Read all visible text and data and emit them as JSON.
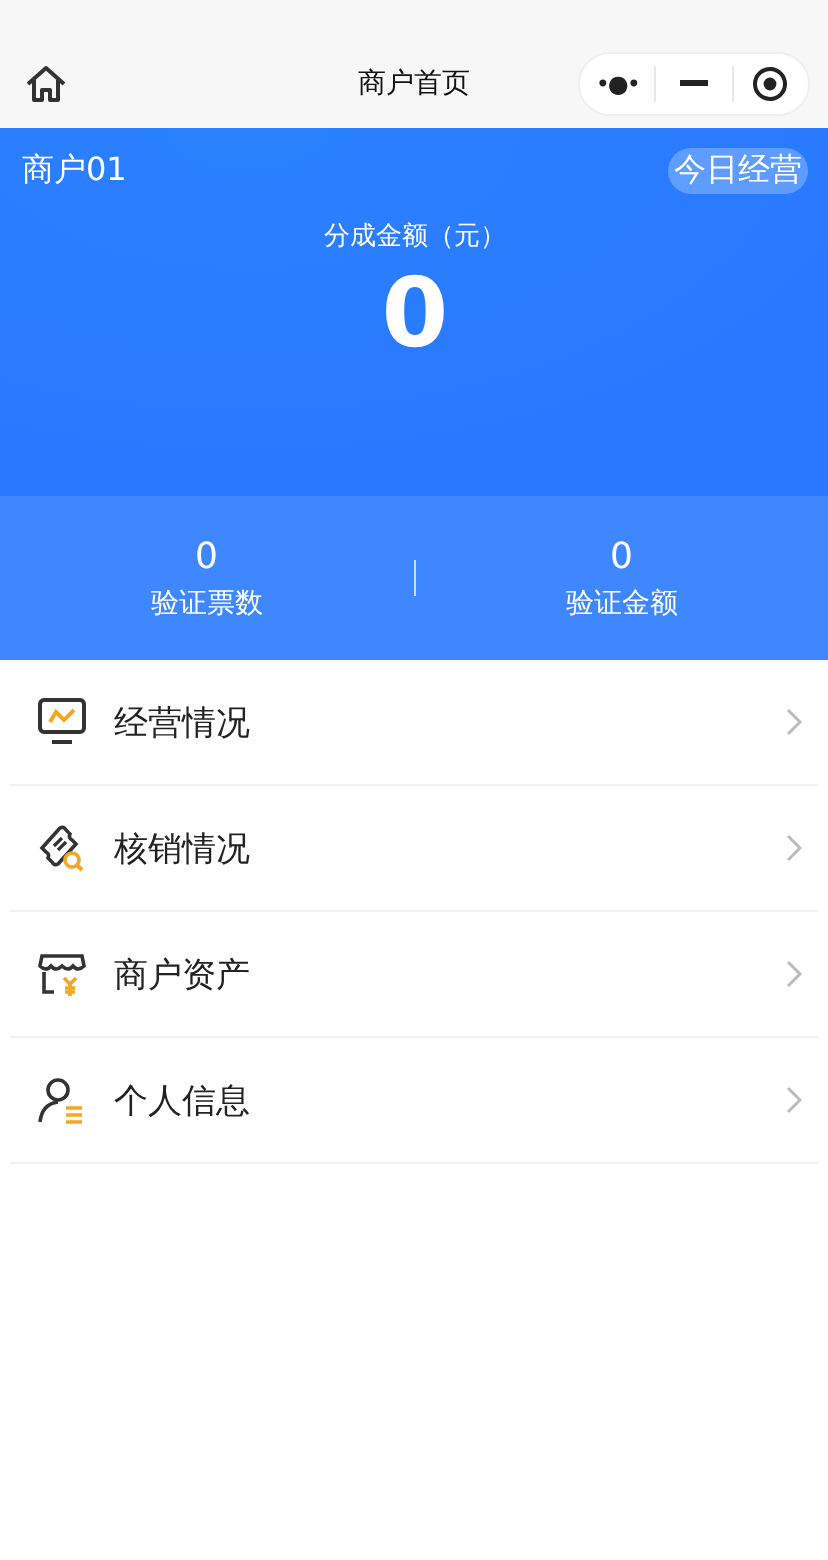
{
  "nav_bar": {
    "title": "商户首页",
    "capsule": {
      "more": "•●•"
    }
  },
  "header": {
    "merchant": "商户01",
    "badge": "今日经营",
    "amount_label": "分成金额（元）",
    "amount": "0"
  },
  "stats": [
    {
      "value": "0",
      "label": "验证票数"
    },
    {
      "value": "0",
      "label": "验证金额"
    }
  ],
  "menu": [
    {
      "kind": "chart",
      "label": "经营情况"
    },
    {
      "kind": "ticket",
      "label": "核销情况"
    },
    {
      "kind": "shop",
      "label": "商户资产"
    },
    {
      "kind": "person",
      "label": "个人信息"
    }
  ]
}
